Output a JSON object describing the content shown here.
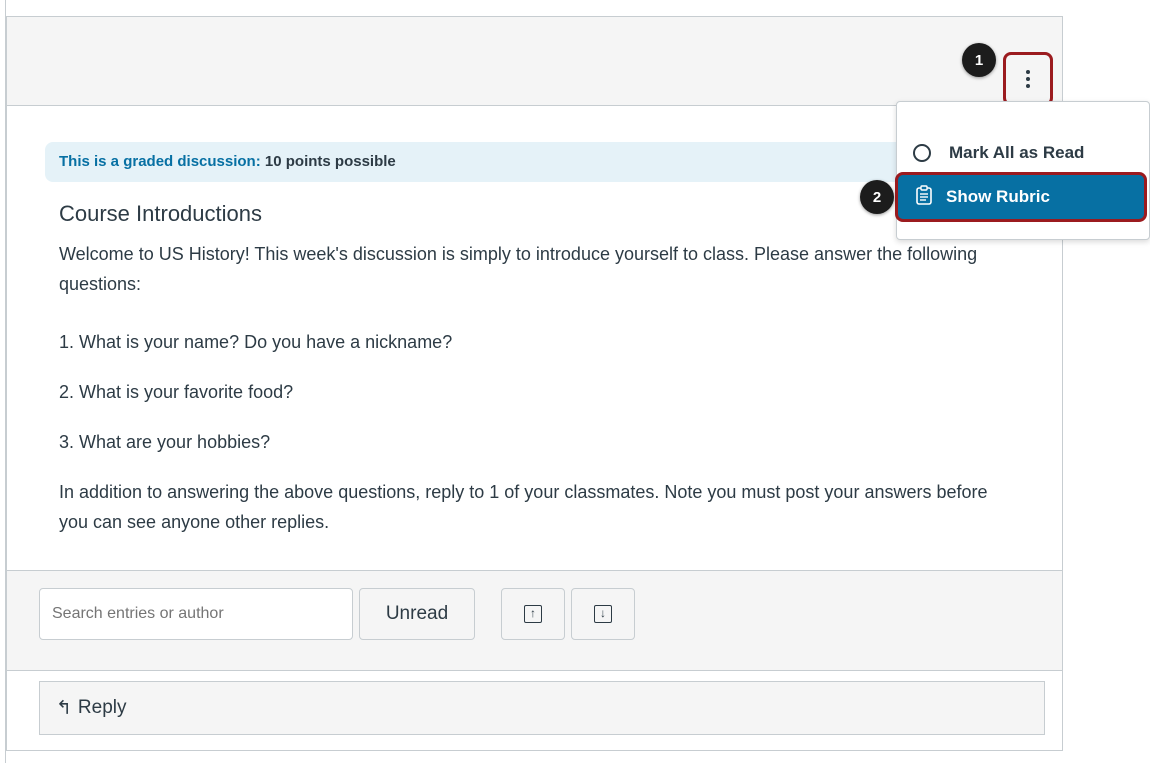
{
  "discussion": {
    "graded_lead": "This is a graded discussion:",
    "graded_points": "10 points possible",
    "title": "Course Introductions",
    "paragraphs": [
      "Welcome to US History! This week's discussion is simply to introduce yourself to class. Please answer the following questions:",
      "1. What is your name? Do you have a nickname?",
      "2. What is your favorite food?",
      "3. What are your hobbies?",
      "In addition to answering the above questions, reply to 1 of your classmates. Note you must post your answers before you can see anyone other replies."
    ]
  },
  "toolbar": {
    "search_placeholder": "Search entries or author",
    "unread_label": "Unread"
  },
  "reply": {
    "label": "Reply"
  },
  "menu": {
    "items": [
      {
        "label": "Mark All as Read"
      },
      {
        "label": "Show Rubric"
      }
    ]
  },
  "callouts": [
    "1",
    "2"
  ],
  "colors": {
    "accent": "#0770a3",
    "highlight_border": "#9b1b1f",
    "text": "#2d3b45"
  }
}
